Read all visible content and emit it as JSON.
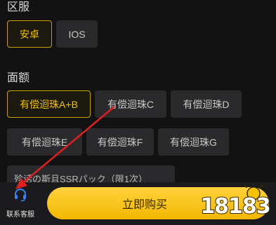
{
  "region": {
    "title": "区服",
    "options": [
      {
        "label": "安卓",
        "selected": true
      },
      {
        "label": "IOS",
        "selected": false
      }
    ]
  },
  "denomination": {
    "title": "面额",
    "options": [
      {
        "label": "有偿迴珠A+B",
        "selected": true
      },
      {
        "label": "有偿迴珠C",
        "selected": false
      },
      {
        "label": "有偿迴珠D",
        "selected": false
      },
      {
        "label": "有偿迴珠E",
        "selected": false
      },
      {
        "label": "有偿迴珠F",
        "selected": false
      },
      {
        "label": "有偿迴珠G",
        "selected": false
      }
    ],
    "partial_option": "殄话の斯且SSRパック（限1次）"
  },
  "bottom": {
    "service_label": "联系客服",
    "service_icon": "headset-icon",
    "buy_label": "立即购买"
  },
  "watermark": {
    "text": "18183"
  },
  "colors": {
    "accent": "#f2c200",
    "background": "#121212",
    "option_bg": "#2a2a2d",
    "annotation_arrow": "#e02020"
  }
}
